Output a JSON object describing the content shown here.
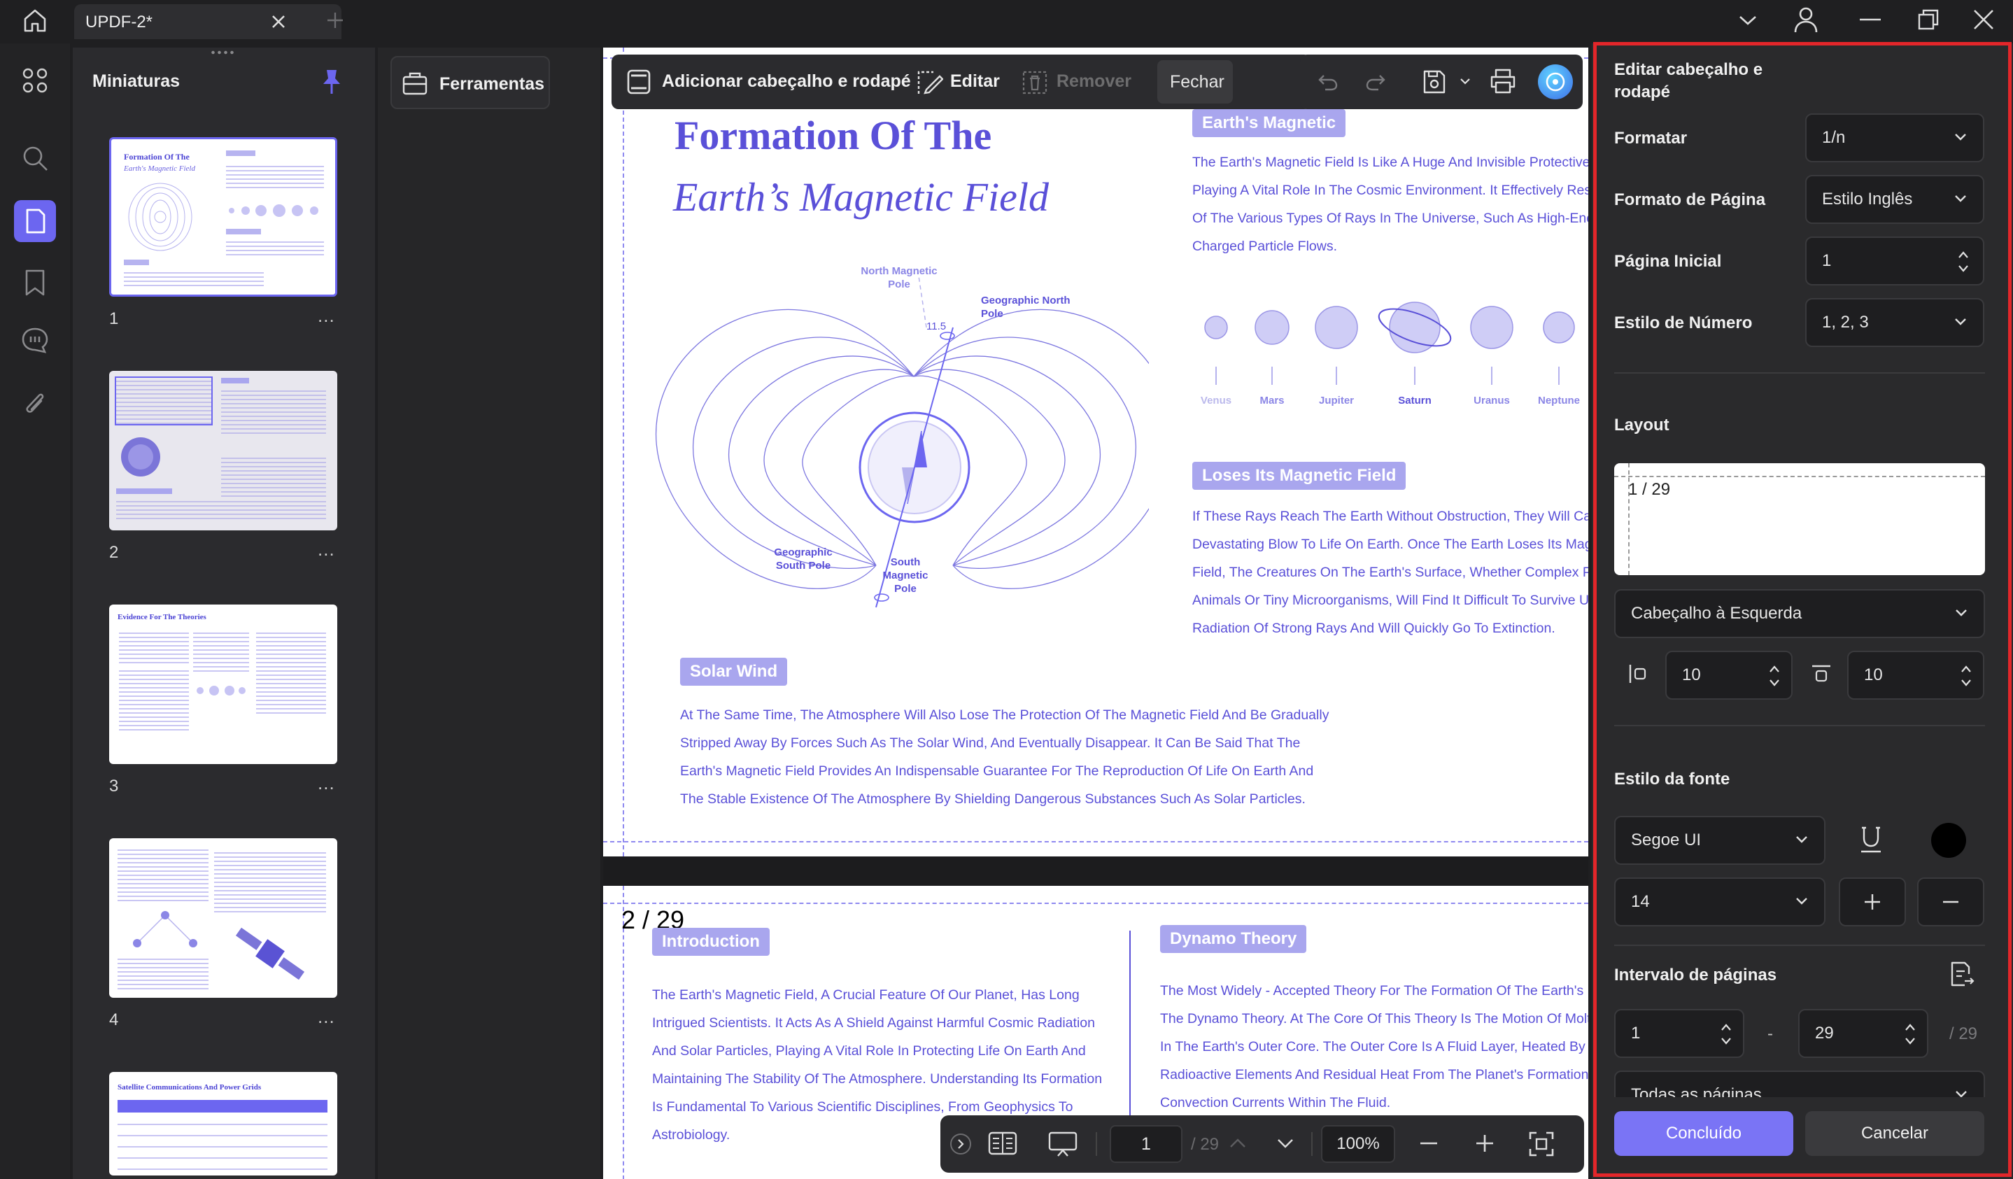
{
  "titlebar": {
    "tab_title": "UPDF-2*"
  },
  "thumbnails": {
    "title": "Miniaturas",
    "pages": [
      {
        "number": "1",
        "heading": "Formation Of The",
        "sub": "Earth's Magnetic Field"
      },
      {
        "number": "2",
        "heading": "",
        "sub": ""
      },
      {
        "number": "3",
        "heading": "Evidence For The Theories",
        "sub": ""
      },
      {
        "number": "4",
        "heading": "",
        "sub": ""
      },
      {
        "number": "",
        "heading": "Satellite Communications And Power Grids",
        "sub": ""
      }
    ],
    "more_label": "..."
  },
  "tools": {
    "label": "Ferramentas"
  },
  "edit_toolbar": {
    "add_header_footer": "Adicionar cabeçalho e rodapé",
    "edit": "Editar",
    "remove": "Remover",
    "close": "Fechar"
  },
  "page1": {
    "title_line1": "Formation Of The",
    "title_line2": "Earth’s Magnetic Field",
    "label_magnetic": "Earth's Magnetic",
    "para_magnetic": [
      "The Earth's Magnetic Field Is Like A Huge And Invisible Protective Sh",
      "Playing A Vital Role In The Cosmic Environment. It Effectively Resist",
      "Of The Various Types Of Rays In The Universe, Such As High-Energ",
      "Charged Particle Flows."
    ],
    "diagram": {
      "north_magnetic": "North Magnetic Pole",
      "geo_north": "Geographic North Pole",
      "angle": "11.5",
      "geo_south": "Geographic South Pole",
      "south": "South Magnetic Pole"
    },
    "planets": [
      "Venus",
      "Mars",
      "Jupiter",
      "Saturn",
      "Uranus",
      "Neptune"
    ],
    "label_loses": "Loses Its Magnetic Field",
    "para_loses": [
      "If These Rays Reach The Earth Without Obstruction, They Will Caus",
      "Devastating Blow To Life On Earth. Once The Earth Loses Its Magne",
      "Field, The Creatures On The Earth's Surface, Whether Complex Pla",
      "Animals Or Tiny Microorganisms, Will Find It Difficult To Survive Und",
      "Radiation Of Strong Rays And Will Quickly Go To Extinction."
    ],
    "label_solar": "Solar Wind",
    "para_solar": [
      "At The Same Time, The Atmosphere Will Also Lose The Protection Of The Magnetic Field And Be Gradually",
      "Stripped Away By Forces Such As The Solar Wind, And Eventually Disappear. It Can Be Said That The",
      "Earth's Magnetic Field Provides An Indispensable Guarantee For The Reproduction Of Life On Earth And",
      "The Stable Existence Of The Atmosphere By Shielding Dangerous Substances Such As Solar Particles."
    ]
  },
  "page2": {
    "header_number": "2 / 29",
    "label_intro": "Introduction",
    "para_intro": [
      "The Earth's Magnetic Field, A Crucial Feature Of Our Planet, Has Long",
      "Intrigued Scientists. It Acts As A Shield Against Harmful Cosmic Radiation",
      "And Solar Particles, Playing A Vital Role In Protecting Life On Earth And",
      "Maintaining The Stability Of The Atmosphere. Understanding Its Formation",
      "Is Fundamental To Various Scientific Disciplines, From Geophysics To",
      "Astrobiology."
    ],
    "label_dynamo": "Dynamo Theory",
    "para_dynamo": [
      "The Most Widely - Accepted Theory For The Formation Of The Earth's Ma",
      "The Dynamo Theory. At The Core Of This Theory Is The Motion Of Molten",
      "In The Earth's Outer Core. The Outer Core Is A Fluid Layer, Heated By Th",
      "Radioactive Elements And Residual Heat From The Planet's Formation. Th",
      "Convection Currents Within The Fluid."
    ]
  },
  "bottom_bar": {
    "page_input": "1",
    "page_total": "/ 29",
    "zoom": "100%"
  },
  "panel": {
    "title": "Editar cabeçalho e rodapé",
    "format_label": "Formatar",
    "format_value": "1/n",
    "page_format_label": "Formato de Página",
    "page_format_value": "Estilo Inglês",
    "start_page_label": "Página Inicial",
    "start_page_value": "1",
    "number_style_label": "Estilo de Número",
    "number_style_value": "1, 2, 3",
    "layout_label": "Layout",
    "layout_preview": "1 / 29",
    "position_value": "Cabeçalho à Esquerda",
    "margin_left": "10",
    "margin_top": "10",
    "font_style_label": "Estilo da fonte",
    "font_value": "Segoe UI",
    "font_color": "#000000",
    "font_size": "14",
    "range_label": "Intervalo de páginas",
    "range_from": "1",
    "range_dash": "-",
    "range_to": "29",
    "range_total": "/ 29",
    "pages_value": "Todas as páginas",
    "done": "Concluído",
    "cancel": "Cancelar"
  },
  "colors": {
    "accent": "#6c66f0",
    "highlight_border": "#e3262a",
    "doc_text": "#5a50d8",
    "label_bg": "#a9a6ee"
  }
}
